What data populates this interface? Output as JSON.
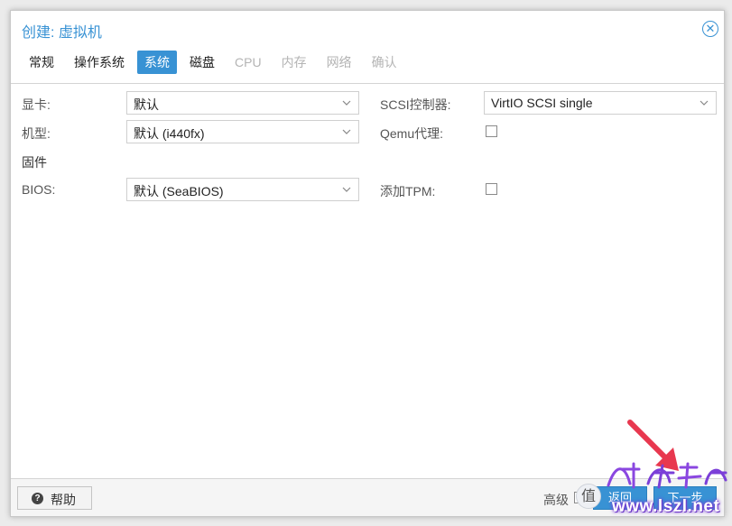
{
  "window": {
    "title": "创建: 虚拟机",
    "close_glyph": "✕"
  },
  "tabs": [
    {
      "label": "常规",
      "state": "normal"
    },
    {
      "label": "操作系统",
      "state": "normal"
    },
    {
      "label": "系统",
      "state": "active"
    },
    {
      "label": "磁盘",
      "state": "normal"
    },
    {
      "label": "CPU",
      "state": "disabled"
    },
    {
      "label": "内存",
      "state": "disabled"
    },
    {
      "label": "网络",
      "state": "disabled"
    },
    {
      "label": "确认",
      "state": "disabled"
    }
  ],
  "form": {
    "graphics_card": {
      "label": "显卡:",
      "value": "默认"
    },
    "machine": {
      "label": "机型:",
      "value": "默认 (i440fx)"
    },
    "firmware_section": "固件",
    "bios": {
      "label": "BIOS:",
      "value": "默认 (SeaBIOS)"
    },
    "scsi_controller": {
      "label": "SCSI控制器:",
      "value": "VirtIO SCSI single"
    },
    "qemu_agent": {
      "label": "Qemu代理:",
      "checked": false
    },
    "add_tpm": {
      "label": "添加TPM:",
      "checked": false
    }
  },
  "footer": {
    "help_label": "帮助",
    "advanced_label": "高级",
    "advanced_checked": false,
    "back_label": "返回",
    "next_label": "下一步"
  },
  "watermark": {
    "badge_glyph": "值",
    "url": "www.lszl.net"
  },
  "colors": {
    "accent": "#3892d4",
    "watermark_purple": "#7b3fd8",
    "arrow_red": "#e8384f"
  },
  "icons": {
    "close": "close-circle-icon",
    "dropdown": "chevron-down-icon",
    "help": "question-circle-icon"
  }
}
